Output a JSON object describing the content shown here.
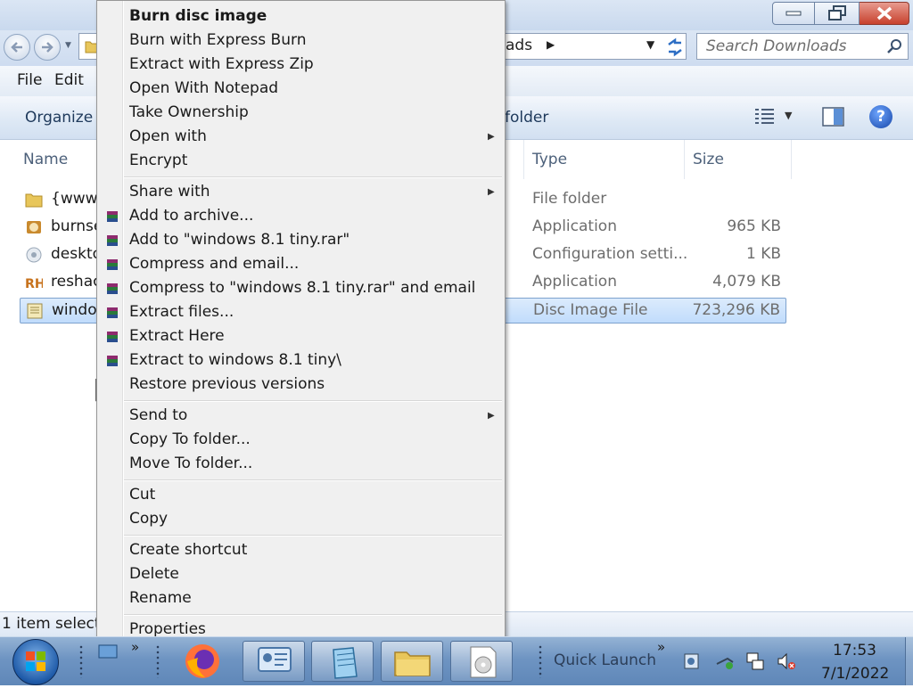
{
  "explorer": {
    "address_visible": "ads",
    "search_placeholder": "Search Downloads",
    "menu": [
      "File",
      "Edit"
    ],
    "toolbar": {
      "organize": "Organize",
      "new_folder": "folder"
    },
    "columns": {
      "name": "Name",
      "type": "Type",
      "size": "Size"
    },
    "files": [
      {
        "name": "{www.",
        "type": "File folder",
        "size": "",
        "icon": "folder-icon"
      },
      {
        "name": "burnse",
        "type": "Application",
        "size": "965 KB",
        "icon": "burn-app-icon"
      },
      {
        "name": "deskto",
        "type": "Configuration setti...",
        "size": "1 KB",
        "icon": "config-file-icon"
      },
      {
        "name": "reshac",
        "type": "Application",
        "size": "4,079 KB",
        "icon": "resource-hacker-icon"
      },
      {
        "name": "windo",
        "type": "Disc Image File",
        "size": "723,296 KB",
        "icon": "disc-image-icon"
      }
    ],
    "status": "1 item selecte"
  },
  "context_menu": {
    "groups": [
      [
        {
          "label": "Burn disc image",
          "bold": true
        },
        {
          "label": "Burn with Express Burn"
        },
        {
          "label": "Extract with Express Zip"
        },
        {
          "label": "Open With Notepad"
        },
        {
          "label": "Take Ownership"
        },
        {
          "label": "Open with",
          "submenu": true
        },
        {
          "label": "Encrypt"
        }
      ],
      [
        {
          "label": "Share with",
          "submenu": true
        },
        {
          "label": "Add to archive...",
          "icon": "winrar-icon"
        },
        {
          "label": "Add to \"windows 8.1 tiny.rar\"",
          "icon": "winrar-icon"
        },
        {
          "label": "Compress and email...",
          "icon": "winrar-icon"
        },
        {
          "label": "Compress to \"windows 8.1 tiny.rar\" and email",
          "icon": "winrar-icon"
        },
        {
          "label": "Extract files...",
          "icon": "winrar-icon"
        },
        {
          "label": "Extract Here",
          "icon": "winrar-icon"
        },
        {
          "label": "Extract to windows 8.1 tiny\\",
          "icon": "winrar-icon"
        },
        {
          "label": "Restore previous versions"
        }
      ],
      [
        {
          "label": "Send to",
          "submenu": true
        },
        {
          "label": "Copy To folder..."
        },
        {
          "label": "Move To folder..."
        }
      ],
      [
        {
          "label": "Cut"
        },
        {
          "label": "Copy"
        }
      ],
      [
        {
          "label": "Create shortcut"
        },
        {
          "label": "Delete"
        },
        {
          "label": "Rename"
        }
      ],
      [
        {
          "label": "Properties"
        }
      ]
    ]
  },
  "taskbar": {
    "quick_launch_label": "Quick Launch",
    "quick_launch_more": "»",
    "clock_time": "17:53",
    "clock_date": "7/1/2022",
    "buttons": [
      "firefox-icon",
      "control-panel-icon",
      "notepad-icon",
      "explorer-folder-icon",
      "disc-image-icon"
    ]
  }
}
